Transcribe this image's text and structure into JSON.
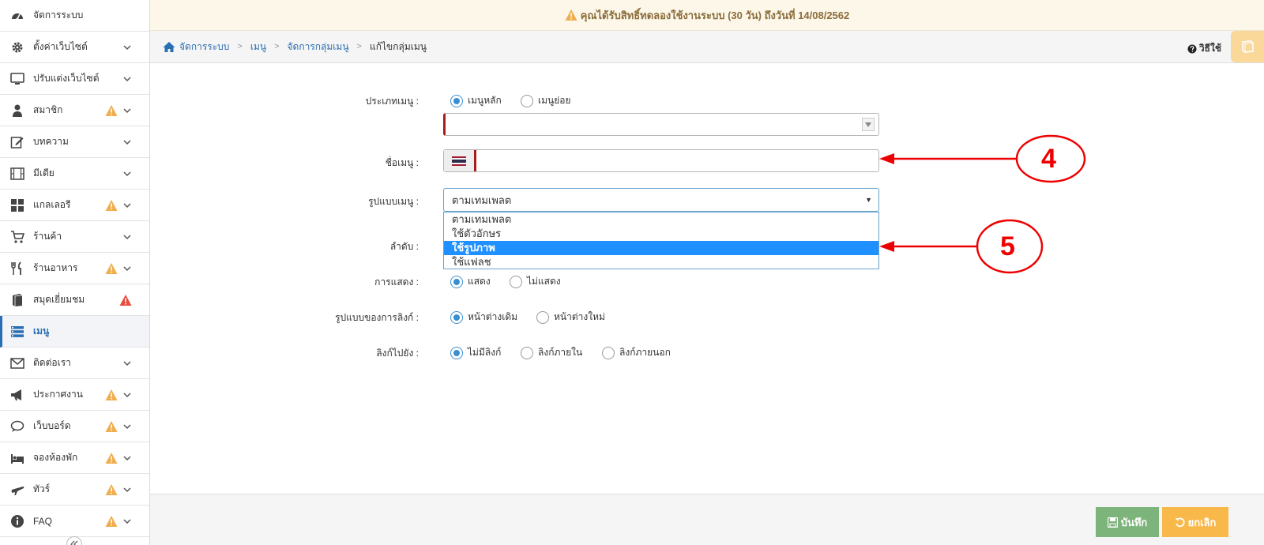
{
  "notice": {
    "text": "คุณได้รับสิทธิ์ทดลองใช้งานระบบ (30 วัน) ถึงวันที่ 14/08/2562"
  },
  "sidebar": {
    "items": [
      {
        "label": "จัดการระบบ",
        "icon": "dashboard-icon"
      },
      {
        "label": "ตั้งค่าเว็บไซต์",
        "icon": "gear-icon"
      },
      {
        "label": "ปรับแต่งเว็บไซต์",
        "icon": "monitor-icon"
      },
      {
        "label": "สมาชิก",
        "icon": "user-icon"
      },
      {
        "label": "บทความ",
        "icon": "edit-icon"
      },
      {
        "label": "มีเดีย",
        "icon": "film-icon"
      },
      {
        "label": "แกลเลอรี",
        "icon": "grid-icon"
      },
      {
        "label": "ร้านค้า",
        "icon": "cart-icon"
      },
      {
        "label": "ร้านอาหาร",
        "icon": "utensils-icon"
      },
      {
        "label": "สมุดเยี่ยมชม",
        "icon": "book-icon"
      },
      {
        "label": "เมนู",
        "icon": "menu-icon"
      },
      {
        "label": "ติดต่อเรา",
        "icon": "envelope-icon"
      },
      {
        "label": "ประกาศงาน",
        "icon": "megaphone-icon"
      },
      {
        "label": "เว็บบอร์ด",
        "icon": "comments-icon"
      },
      {
        "label": "จองห้องพัก",
        "icon": "bed-icon"
      },
      {
        "label": "ทัวร์",
        "icon": "plane-icon"
      },
      {
        "label": "FAQ",
        "icon": "info-icon"
      }
    ]
  },
  "breadcrumb": {
    "home": "จัดการระบบ",
    "menu": "เมนู",
    "group": "จัดการกลุ่มเมนู",
    "current": "แก้ไขกลุ่มเมนู"
  },
  "help": {
    "label": "วิธีใช้"
  },
  "form": {
    "menu_type": {
      "label": "ประเภทเมนู :",
      "options": [
        "เมนูหลัก",
        "เมนูย่อย"
      ],
      "selected": "เมนูหลัก"
    },
    "menu_name": {
      "label": "ชื่อเมนู :",
      "value": ""
    },
    "menu_format": {
      "label": "รูปแบบเมนู :",
      "value": "ตามเทมเพลต",
      "options": [
        "ตามเทมเพลต",
        "ใช้ตัวอักษร",
        "ใช้รูปภาพ",
        "ใช้แฟลช"
      ],
      "highlighted": "ใช้รูปภาพ"
    },
    "order": {
      "label": "ลำดับ :"
    },
    "display": {
      "label": "การแสดง :",
      "options": [
        "แสดง",
        "ไม่แสดง"
      ],
      "selected": "แสดง"
    },
    "link_style": {
      "label": "รูปแบบของการลิงก์ :",
      "options": [
        "หน้าต่างเดิม",
        "หน้าต่างใหม่"
      ],
      "selected": "หน้าต่างเดิม"
    },
    "link_to": {
      "label": "ลิงก์ไปยัง :",
      "options": [
        "ไม่มีลิงก์",
        "ลิงก์ภายใน",
        "ลิงก์ภายนอก"
      ],
      "selected": "ไม่มีลิงก์"
    }
  },
  "annotations": {
    "step4": "4",
    "step5": "5"
  },
  "footer": {
    "save_label": "บันทึก",
    "cancel_label": "ยกเลิก"
  },
  "colors": {
    "accent": "#2a6fb3",
    "warning": "#f0ad4e",
    "danger": "#e74c3c",
    "annotation": "#e00000",
    "save": "#7db47b",
    "cancel": "#f8b84a"
  }
}
